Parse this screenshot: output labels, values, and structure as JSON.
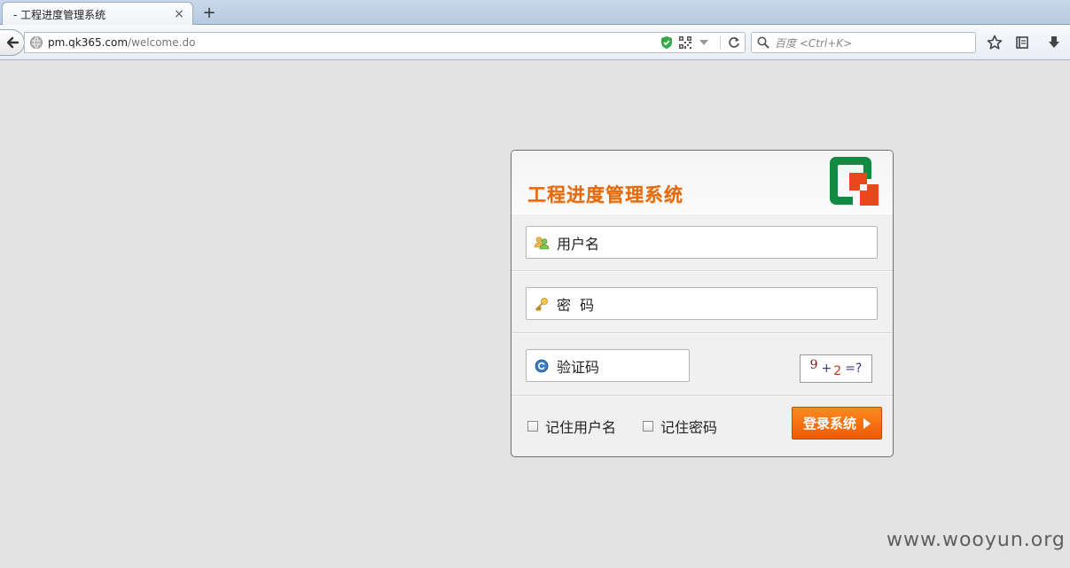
{
  "browser": {
    "tab_title": "- 工程进度管理系统",
    "tab_close": "×",
    "new_tab": "+",
    "url_host": "pm.qk365.com",
    "url_path": "/welcome.do",
    "search_placeholder": "百度 <Ctrl+K>"
  },
  "login": {
    "system_title": "工程进度管理系统",
    "username_placeholder": "用户名",
    "password_placeholder": "密  码",
    "captcha_placeholder": "验证码",
    "captcha": {
      "a": "9",
      "op": "+",
      "b": "2",
      "eq": "=?"
    },
    "remember_username": "记住用户名",
    "remember_password": "记住密码",
    "login_button": "登录系统"
  },
  "watermark": "www.wooyun.org",
  "colors": {
    "title_orange": "#e46a10",
    "button_orange": "#f26b0c",
    "logo_green": "#138a43",
    "logo_red": "#e8481c"
  },
  "icons": {
    "user": "users-icon",
    "password": "key-icon",
    "captcha": "refresh-circle-icon"
  }
}
